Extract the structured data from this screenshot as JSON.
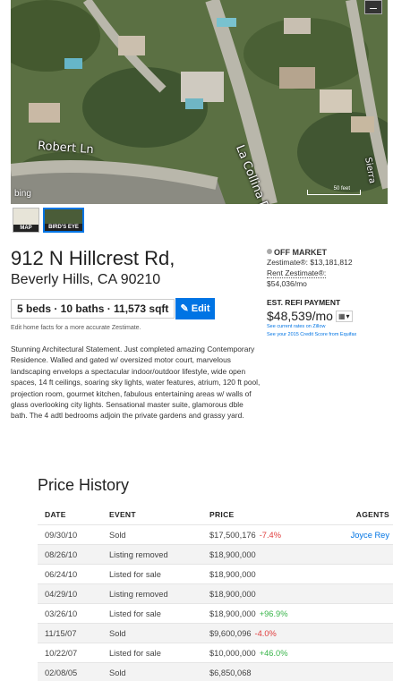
{
  "map": {
    "street_labels": [
      "Robert Ln",
      "La Collina Dr",
      "Sierra"
    ],
    "bing_label": "bing",
    "scale_label": "50 feet",
    "fullscreen_icon": "minus-icon"
  },
  "thumbnails": [
    {
      "label": "MAP"
    },
    {
      "label": "BIRD'S EYE"
    }
  ],
  "address": {
    "line1": "912 N Hillcrest Rd,",
    "line2": "Beverly Hills, CA 90210"
  },
  "facts": "5 beds · 10 baths · 11,573 sqft",
  "edit_label": "Edit",
  "edit_hint": "Edit home facts for a more accurate Zestimate.",
  "description": "Stunning Architectural Statement. Just completed amazing Contemporary Residence. Walled and gated w/ oversized motor court, marvelous landscaping envelops a spectacular indoor/outdoor lifestyle, wide open spaces, 14 ft ceilings, soaring sky lights, water features, atrium, 120 ft pool, projection room, gourmet kitchen, fabulous entertaining areas w/ walls of glass overlooking city lights. Sensational master suite, glamorous dble bath. The 4 adtl bedrooms adjoin the private gardens and grassy yard.",
  "status": {
    "label": "OFF MARKET",
    "zestimate_label": "Zestimate®:",
    "zestimate_value": "$13,181,812",
    "rent_label": "Rent Zestimate®:",
    "rent_value": "$54,036/mo",
    "refi_heading": "EST. REFI PAYMENT",
    "refi_value": "$48,539/mo",
    "rates_link": "See current rates on Zillow",
    "credit_link": "See your 2015 Credit Score from Equifax"
  },
  "price_history": {
    "title": "Price History",
    "headers": [
      "DATE",
      "EVENT",
      "PRICE",
      "AGENTS"
    ],
    "rows": [
      {
        "date": "09/30/10",
        "event": "Sold",
        "price": "$17,500,176",
        "change": "-7.4%",
        "agent": "Joyce Rey"
      },
      {
        "date": "08/26/10",
        "event": "Listing removed",
        "price": "$18,900,000",
        "change": "",
        "agent": ""
      },
      {
        "date": "06/24/10",
        "event": "Listed for sale",
        "price": "$18,900,000",
        "change": "",
        "agent": ""
      },
      {
        "date": "04/29/10",
        "event": "Listing removed",
        "price": "$18,900,000",
        "change": "",
        "agent": ""
      },
      {
        "date": "03/26/10",
        "event": "Listed for sale",
        "price": "$18,900,000",
        "change": "+96.9%",
        "agent": ""
      },
      {
        "date": "11/15/07",
        "event": "Sold",
        "price": "$9,600,096",
        "change": "-4.0%",
        "agent": ""
      },
      {
        "date": "10/22/07",
        "event": "Listed for sale",
        "price": "$10,000,000",
        "change": "+46.0%",
        "agent": ""
      },
      {
        "date": "02/08/05",
        "event": "Sold",
        "price": "$6,850,068",
        "change": "",
        "agent": ""
      }
    ]
  },
  "colors": {
    "accent": "#0074e4",
    "negative": "#e03d3d",
    "positive": "#39b54a"
  }
}
